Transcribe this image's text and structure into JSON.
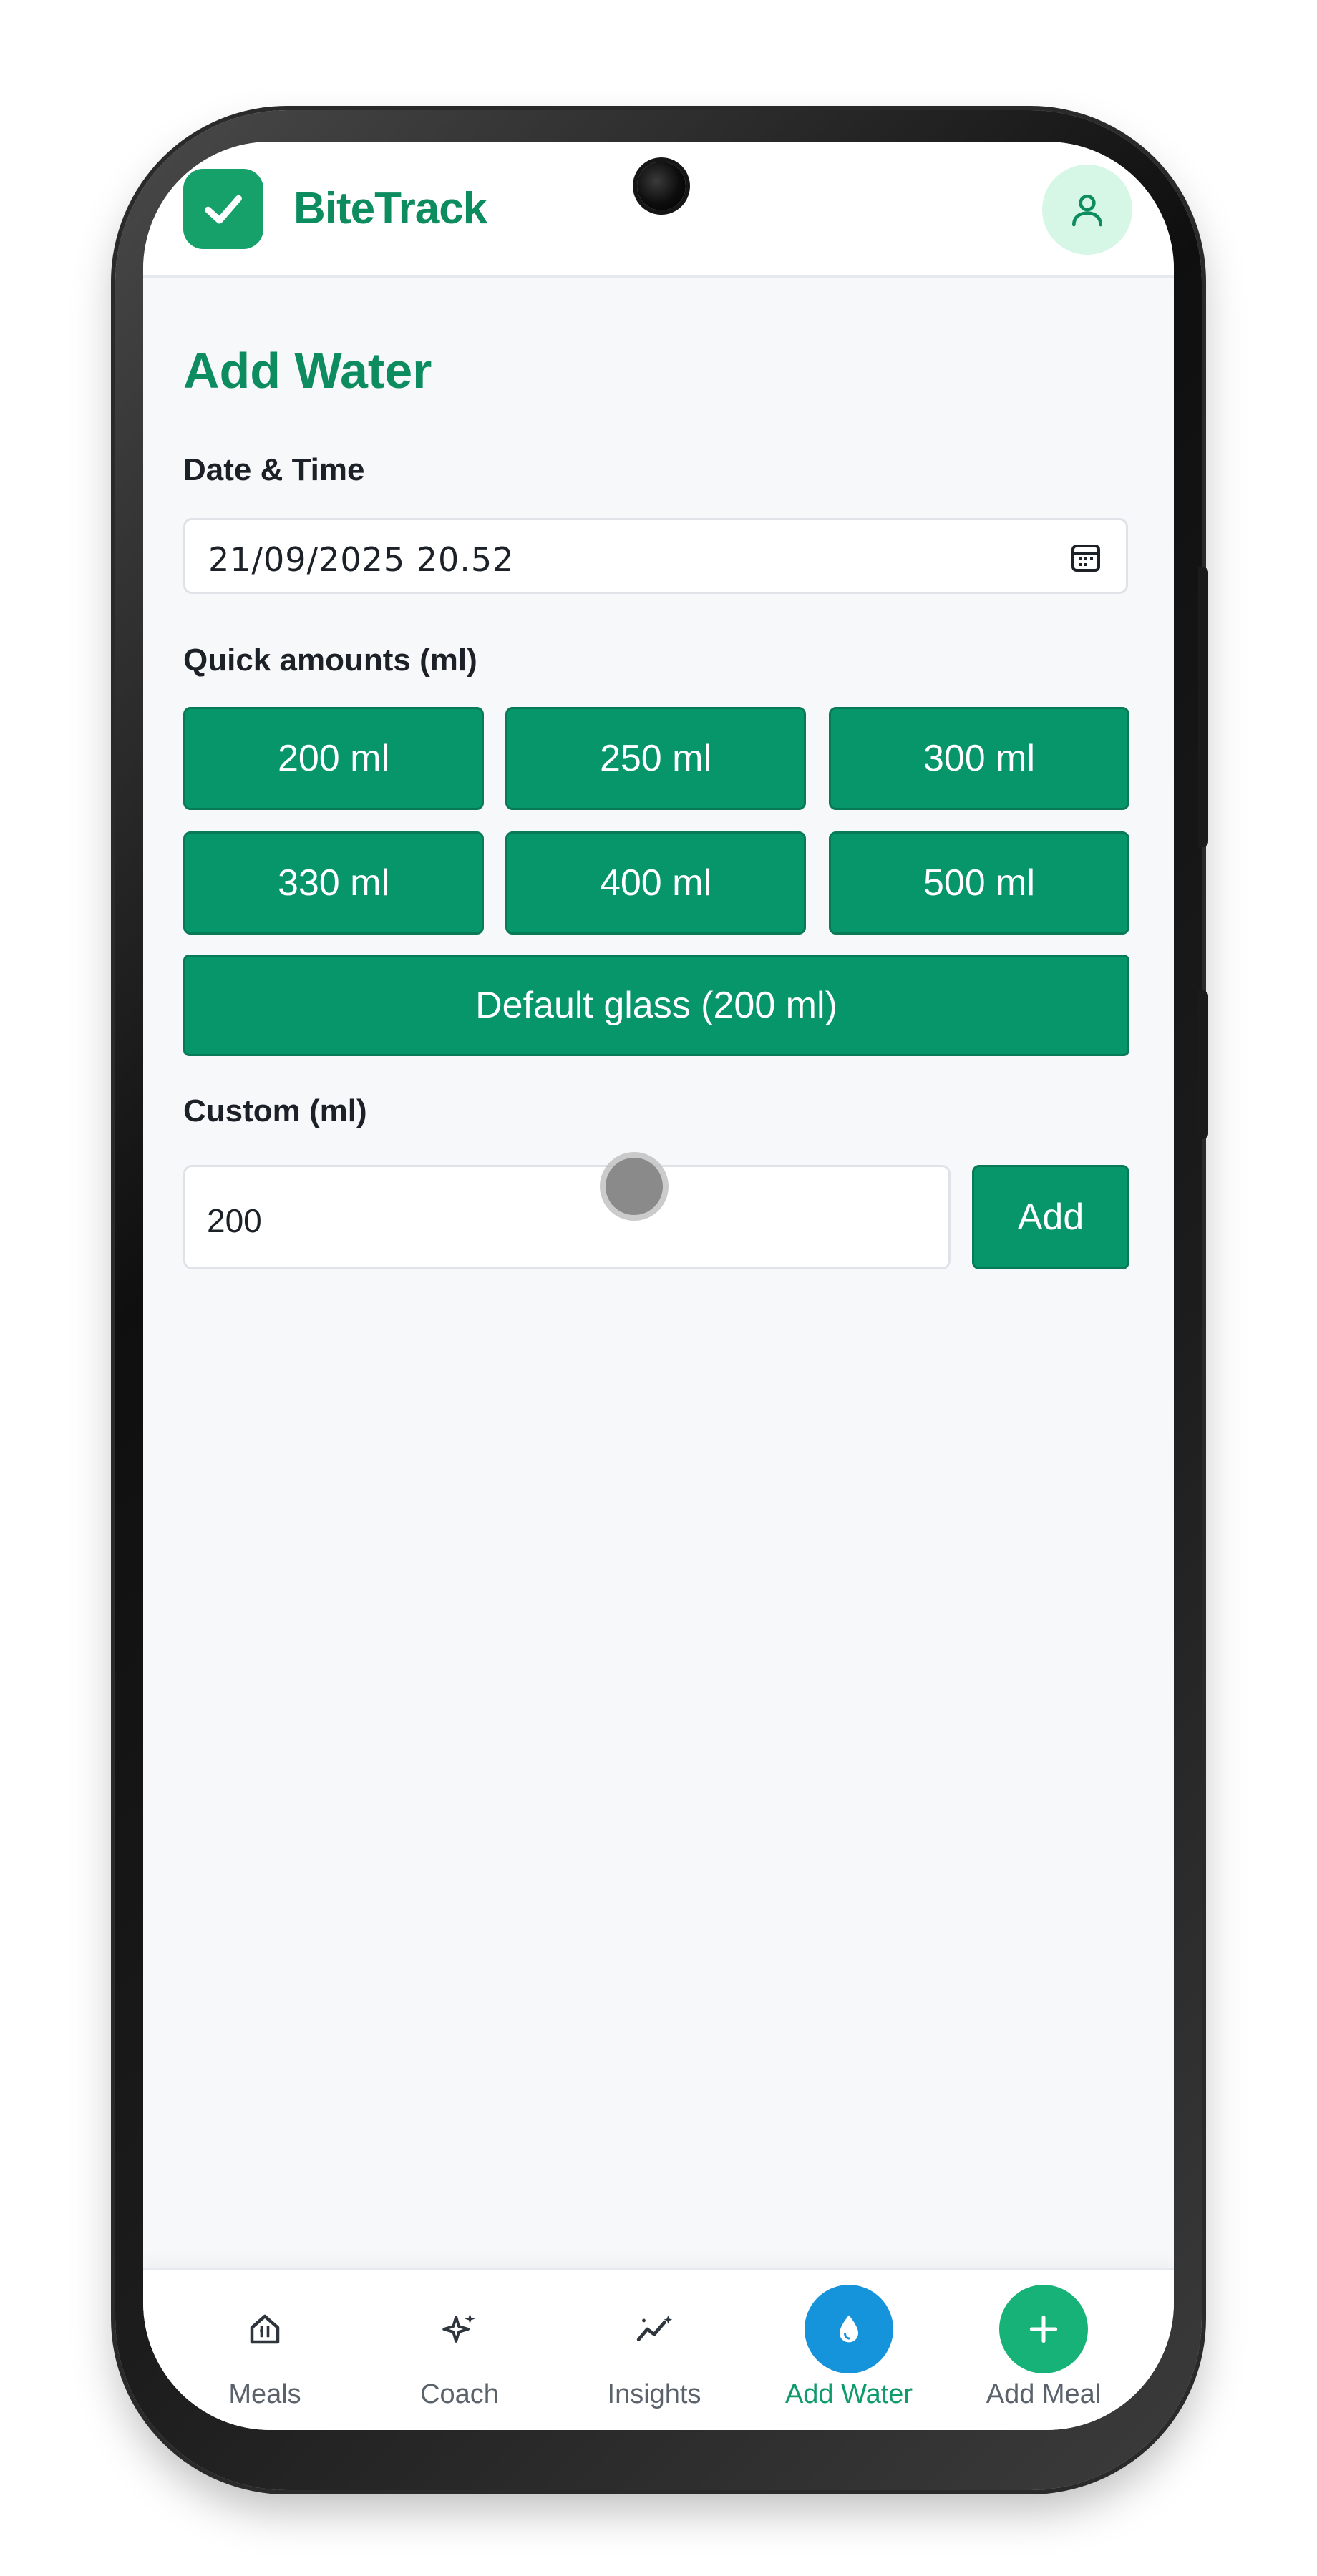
{
  "app": {
    "brand": "BiteTrack",
    "colors": {
      "brand": "#0d8c60",
      "primary_button": "#079669",
      "water_accent": "#1593db",
      "meal_accent": "#17b277",
      "background": "#f7f8fa"
    },
    "icons": {
      "logo": "check-badge-icon",
      "profile": "user-icon"
    }
  },
  "page": {
    "title": "Add Water",
    "date_time": {
      "label": "Date & Time",
      "value": "21/09/2025 20.52",
      "icon": "calendar-icon"
    },
    "quick_amounts": {
      "label": "Quick amounts (ml)",
      "buttons": [
        "200 ml",
        "250 ml",
        "300 ml",
        "330 ml",
        "400 ml",
        "500 ml"
      ],
      "default_button": "Default glass (200 ml)"
    },
    "custom": {
      "label": "Custom (ml)",
      "value": "200",
      "add_label": "Add"
    }
  },
  "nav": {
    "items": [
      {
        "label": "Meals",
        "icon": "home-icon"
      },
      {
        "label": "Coach",
        "icon": "sparkle-icon"
      },
      {
        "label": "Insights",
        "icon": "trend-icon"
      },
      {
        "label": "Add Water",
        "icon": "water-drop-icon",
        "active": true
      },
      {
        "label": "Add Meal",
        "icon": "plus-icon"
      }
    ]
  }
}
